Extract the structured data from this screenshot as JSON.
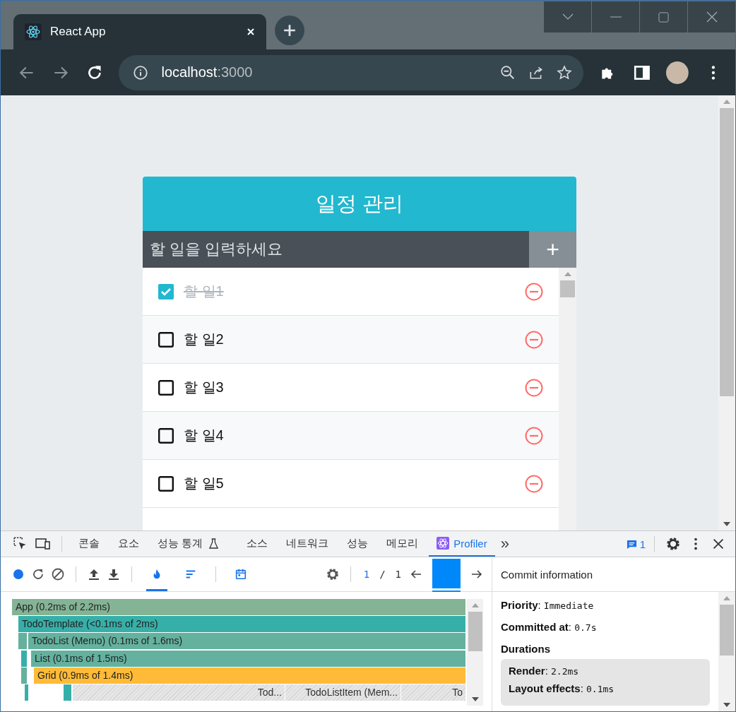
{
  "browser": {
    "tab_title": "React App",
    "url_host": "localhost",
    "url_port": ":3000"
  },
  "todo": {
    "title": "일정 관리",
    "input_placeholder": "할 일을 입력하세요",
    "add_label": "+",
    "items": [
      {
        "text": "할 일1",
        "checked": true
      },
      {
        "text": "할 일2",
        "checked": false
      },
      {
        "text": "할 일3",
        "checked": false
      },
      {
        "text": "할 일4",
        "checked": false
      },
      {
        "text": "할 일5",
        "checked": false
      }
    ]
  },
  "devtools": {
    "tabs": [
      {
        "label": "콘솔",
        "selected": false,
        "kind": "plain"
      },
      {
        "label": "요소",
        "selected": false,
        "kind": "plain"
      },
      {
        "label": "성능 통계",
        "selected": false,
        "kind": "flask"
      },
      {
        "label": "소스",
        "selected": false,
        "kind": "plain"
      },
      {
        "label": "네트워크",
        "selected": false,
        "kind": "plain"
      },
      {
        "label": "성능",
        "selected": false,
        "kind": "plain"
      },
      {
        "label": "메모리",
        "selected": false,
        "kind": "plain"
      },
      {
        "label": "Profiler",
        "selected": true,
        "kind": "react"
      }
    ],
    "more_label": "»",
    "issues_count": "1",
    "views": [
      {
        "kind": "flame",
        "selected": true
      },
      {
        "kind": "ranked",
        "selected": false
      },
      {
        "kind": "timeline",
        "selected": false
      }
    ],
    "commit_current": "1",
    "commit_separator": "/",
    "commit_total": "1",
    "flame_rows": [
      {
        "bars": [
          {
            "kind": "bar",
            "label": "App (0.2ms of 2.2ms)",
            "color": "#84b395"
          }
        ]
      },
      {
        "bars": [
          {
            "kind": "bar",
            "label": "TodoTemplate (<0.1ms of 2ms)",
            "color": "#37afa9"
          }
        ]
      },
      {
        "bars": [
          {
            "kind": "bar",
            "color": "#66b19c"
          },
          {
            "kind": "bar",
            "label": "TodoList (Memo) (0.1ms of 1.6ms)",
            "color": "#64b19e"
          }
        ]
      },
      {
        "bars": [
          {
            "kind": "bar",
            "color": "#37afa9"
          },
          {
            "kind": "bar",
            "label": "List (0.1ms of 1.5ms)",
            "color": "#63b19e"
          }
        ]
      },
      {
        "bars": [
          {
            "kind": "bar",
            "color": "#66b19c"
          },
          {
            "kind": "bar",
            "label": "Grid (0.9ms of 1.4ms)",
            "color": "#ffbb37"
          }
        ]
      },
      {
        "bars": [
          {
            "kind": "bar",
            "color": "#37afa9"
          },
          {
            "kind": "bar",
            "color": "#37afa9"
          },
          {
            "kind": "hatched",
            "label": "Tod...",
            "color": "#e6e6e6"
          },
          {
            "kind": "hatched",
            "label": "TodoListItem (Mem...",
            "color": "#e6e6e6"
          },
          {
            "kind": "hatched",
            "label": "To",
            "color": "#e6e6e6"
          }
        ]
      }
    ],
    "commit_info": {
      "title": "Commit information",
      "lines": [
        {
          "label": "Priority",
          "separator": ":",
          "value": "Immediate"
        },
        {
          "label": "Committed at",
          "separator": ":",
          "value": "0.7s"
        }
      ],
      "durations_title": "Durations",
      "durations": [
        {
          "label": "Render",
          "separator": ":",
          "value": "2.2ms"
        },
        {
          "label": "Layout effects",
          "separator": ":",
          "value": "0.1ms"
        }
      ]
    }
  }
}
